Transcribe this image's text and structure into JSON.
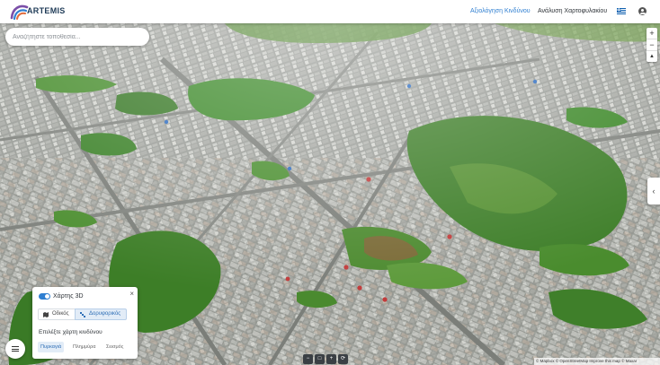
{
  "header": {
    "brand": "ARTEMIS",
    "nav": [
      {
        "label": "Αξιολόγηση Κινδύνου",
        "active": true
      },
      {
        "label": "Ανάλυση Χαρτοφυλακίου",
        "active": false
      }
    ],
    "language_icon": "greek-flag-icon",
    "account_icon": "account-circle-icon"
  },
  "search": {
    "placeholder": "Αναζήτηστε τοποθεσία..."
  },
  "zoom": {
    "in_label": "+",
    "out_label": "−",
    "compass_label": "▲"
  },
  "side_toggle": {
    "label": "‹"
  },
  "map_panel": {
    "close_label": "×",
    "toggle_label": "Χάρτης 3D",
    "toggle_on": true,
    "base_layers": [
      {
        "label": "Οδικός",
        "icon": "map-icon",
        "selected": false
      },
      {
        "label": "Δορυφορικός",
        "icon": "satellite-icon",
        "selected": true
      }
    ],
    "hazard_title": "Επιλέξτε χάρτη κινδύνου",
    "hazards": [
      {
        "label": "Πυρκαγιά",
        "selected": true
      },
      {
        "label": "Πλημμύρα",
        "selected": false
      },
      {
        "label": "Σεισμός",
        "selected": false
      }
    ]
  },
  "menu_button": {
    "icon": "hamburger-menu-icon"
  },
  "map_controls": [
    "−",
    "□",
    "+",
    "⟳"
  ],
  "attribution": "© Mapbox © OpenStreetMap Improve this map © Maxar",
  "colors": {
    "accent": "#2f7fd1",
    "brand_dark": "#1f3b57",
    "vegetation": "#3d8a2a"
  }
}
